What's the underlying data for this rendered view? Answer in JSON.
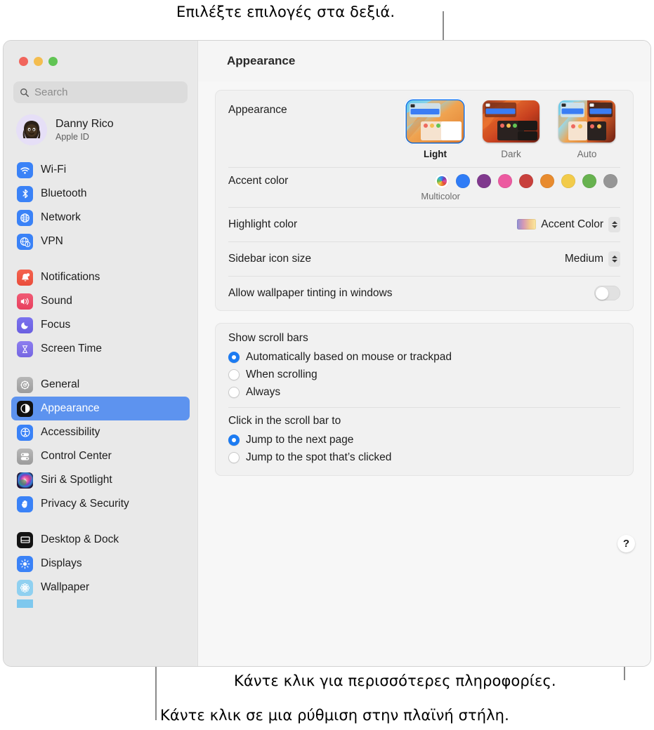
{
  "annotations": {
    "top": "Επιλέξτε επιλογές στα δεξιά.",
    "bottom_right": "Κάντε κλικ για περισσότερες πληροφορίες.",
    "bottom_left": "Κάντε κλικ σε μια ρύθμιση στην πλαϊνή στήλη."
  },
  "window": {
    "title": "Appearance"
  },
  "sidebar": {
    "search": {
      "placeholder": "Search"
    },
    "account": {
      "name": "Danny Rico",
      "subtitle": "Apple ID"
    },
    "groups": [
      {
        "items": [
          {
            "label": "Wi-Fi",
            "icon": "wifi-icon",
            "selected": false
          },
          {
            "label": "Bluetooth",
            "icon": "bluetooth-icon",
            "selected": false
          },
          {
            "label": "Network",
            "icon": "network-icon",
            "selected": false
          },
          {
            "label": "VPN",
            "icon": "vpn-icon",
            "selected": false
          }
        ]
      },
      {
        "items": [
          {
            "label": "Notifications",
            "icon": "bell-icon",
            "selected": false
          },
          {
            "label": "Sound",
            "icon": "speaker-icon",
            "selected": false
          },
          {
            "label": "Focus",
            "icon": "moon-icon",
            "selected": false
          },
          {
            "label": "Screen Time",
            "icon": "hourglass-icon",
            "selected": false
          }
        ]
      },
      {
        "items": [
          {
            "label": "General",
            "icon": "gear-icon",
            "selected": false
          },
          {
            "label": "Appearance",
            "icon": "appearance-icon",
            "selected": true
          },
          {
            "label": "Accessibility",
            "icon": "accessibility-icon",
            "selected": false
          },
          {
            "label": "Control Center",
            "icon": "control-center-icon",
            "selected": false
          },
          {
            "label": "Siri & Spotlight",
            "icon": "siri-icon",
            "selected": false
          },
          {
            "label": "Privacy & Security",
            "icon": "hand-icon",
            "selected": false
          }
        ]
      },
      {
        "items": [
          {
            "label": "Desktop & Dock",
            "icon": "desktop-dock-icon",
            "selected": false
          },
          {
            "label": "Displays",
            "icon": "display-icon",
            "selected": false
          },
          {
            "label": "Wallpaper",
            "icon": "wallpaper-icon",
            "selected": false
          }
        ]
      }
    ]
  },
  "main": {
    "appearance": {
      "label": "Appearance",
      "themes": [
        {
          "label": "Light",
          "selected": true
        },
        {
          "label": "Dark",
          "selected": false
        },
        {
          "label": "Auto",
          "selected": false
        }
      ]
    },
    "accent": {
      "label": "Accent color",
      "caption": "Multicolor",
      "swatches": [
        {
          "name": "multicolor",
          "color": "multicolor",
          "selected": true
        },
        {
          "name": "blue",
          "color": "#2f7cf6",
          "selected": false
        },
        {
          "name": "purple",
          "color": "#80398e",
          "selected": false
        },
        {
          "name": "pink",
          "color": "#ec5aa0",
          "selected": false
        },
        {
          "name": "red",
          "color": "#c8403c",
          "selected": false
        },
        {
          "name": "orange",
          "color": "#e88b2e",
          "selected": false
        },
        {
          "name": "yellow",
          "color": "#f2cb4a",
          "selected": false
        },
        {
          "name": "green",
          "color": "#67b24f",
          "selected": false
        },
        {
          "name": "graphite",
          "color": "#969696",
          "selected": false
        }
      ]
    },
    "highlight": {
      "label": "Highlight color",
      "value": "Accent Color"
    },
    "sidebar_icon_size": {
      "label": "Sidebar icon size",
      "value": "Medium"
    },
    "wallpaper_tinting": {
      "label": "Allow wallpaper tinting in windows",
      "on": false
    },
    "scroll_bars": {
      "title": "Show scroll bars",
      "options": [
        {
          "label": "Automatically based on mouse or trackpad",
          "selected": true
        },
        {
          "label": "When scrolling",
          "selected": false
        },
        {
          "label": "Always",
          "selected": false
        }
      ]
    },
    "scroll_click": {
      "title": "Click in the scroll bar to",
      "options": [
        {
          "label": "Jump to the next page",
          "selected": true
        },
        {
          "label": "Jump to the spot that’s clicked",
          "selected": false
        }
      ]
    },
    "help_button": {
      "label": "?"
    }
  },
  "colors": {
    "accent_blue": "#1c7bf2",
    "selection_blue": "#5d93ef",
    "sidebar_bg": "#e9e9e9",
    "content_bg": "#f7f7f7"
  }
}
